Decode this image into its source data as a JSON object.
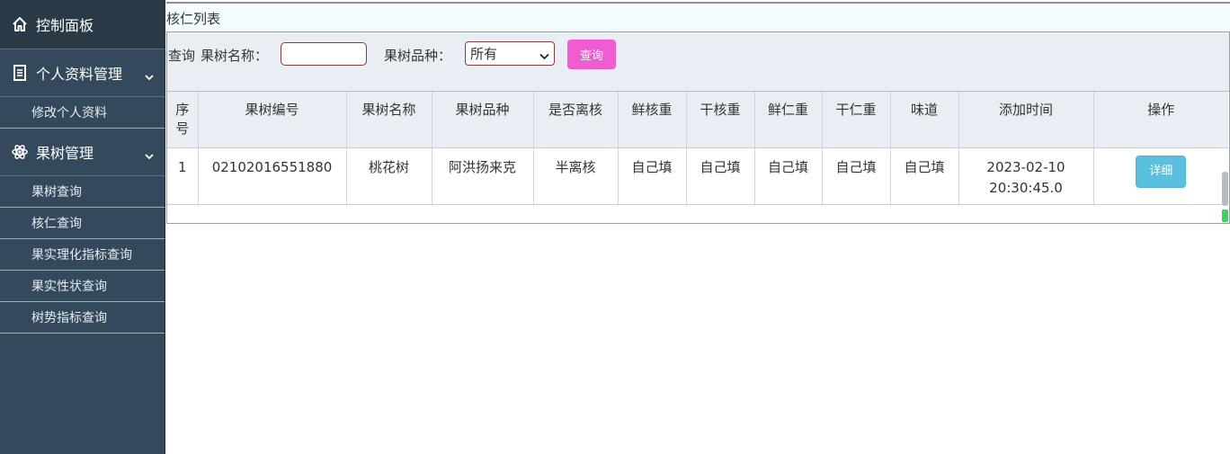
{
  "sidebar": {
    "dashboard": {
      "label": "控制面板",
      "icon": "home-icon"
    },
    "groups": [
      {
        "label": "个人资料管理",
        "icon": "document-icon",
        "items": [
          "修改个人资料"
        ]
      },
      {
        "label": "果树管理",
        "icon": "atom-icon",
        "items": [
          "果树查询",
          "核仁查询",
          "果实理化指标查询",
          "果实性状查询",
          "树势指标查询"
        ]
      }
    ]
  },
  "panel": {
    "title": "核仁列表"
  },
  "search": {
    "query_label": "查询",
    "name_label": "果树名称：",
    "name_value": "",
    "variety_label": "果树品种：",
    "variety_selected": "所有",
    "button": "查询"
  },
  "table": {
    "headers": [
      "序号",
      "果树编号",
      "果树名称",
      "果树品种",
      "是否离核",
      "鲜核重",
      "干核重",
      "鲜仁重",
      "干仁重",
      "味道",
      "添加时间",
      "操作"
    ],
    "rows": [
      {
        "index": "1",
        "code": "02102016551880",
        "name": "桃花树",
        "variety": "阿洪扬来克",
        "pit_free": "半离核",
        "fresh_pit": "自己填",
        "dry_pit": "自己填",
        "fresh_kernel": "自己填",
        "dry_kernel": "自己填",
        "taste": "自己填",
        "added_date": "2023-02-10",
        "added_time": "20:30:45.0",
        "action": "详细"
      }
    ]
  },
  "colors": {
    "sidebar_bg": "#34495b",
    "query_button": "#f15cd3",
    "detail_button": "#5bc0de"
  }
}
